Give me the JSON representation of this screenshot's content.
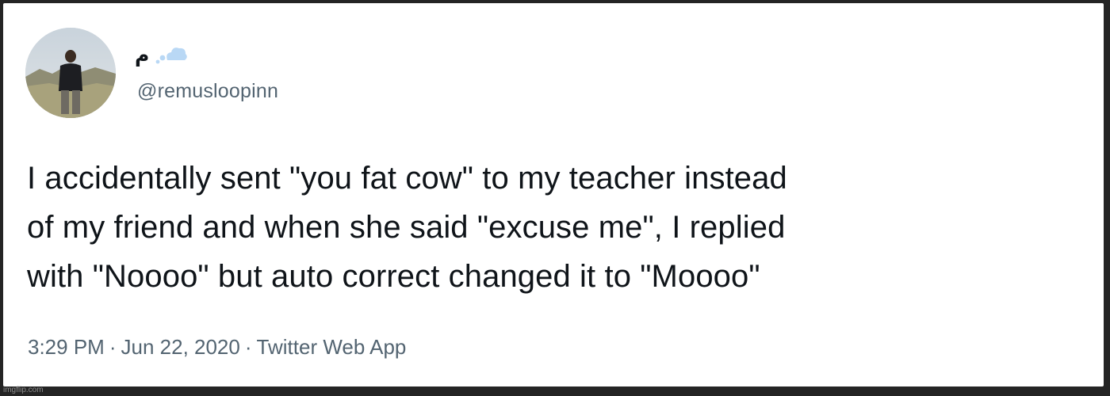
{
  "user": {
    "display_name": "م",
    "handle": "@remusloopinn",
    "avatar_icon": "profile-photo-man-standing-in-field",
    "badge_icon": "cloud-icon",
    "badge_color": "#b9d8f5"
  },
  "tweet": {
    "lines": [
      "I accidentally sent \"you fat cow\" to my teacher instead",
      "of my friend and when she said \"excuse me\", I replied",
      "with \"Noooo\" but auto correct changed it to \"Moooo\""
    ]
  },
  "meta": {
    "time": "3:29 PM",
    "separator": "·",
    "date": "Jun 22, 2020",
    "source": "Twitter Web App"
  },
  "watermark": "imgflip.com"
}
